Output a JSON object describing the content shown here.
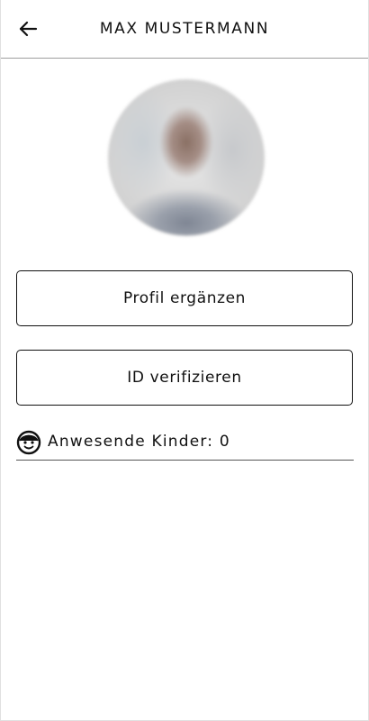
{
  "header": {
    "title": "MAX MUSTERMANN",
    "back_icon": "arrow-left-icon"
  },
  "profile": {
    "avatar_icon": "profile-photo"
  },
  "actions": {
    "complete_profile_label": "Profil ergänzen",
    "verify_id_label": "ID verifizieren"
  },
  "children": {
    "icon": "child-face-icon",
    "label": "Anwesende Kinder: 0"
  },
  "colors": {
    "text": "#111111",
    "background": "#ffffff",
    "divider": "#9e9e9e"
  }
}
